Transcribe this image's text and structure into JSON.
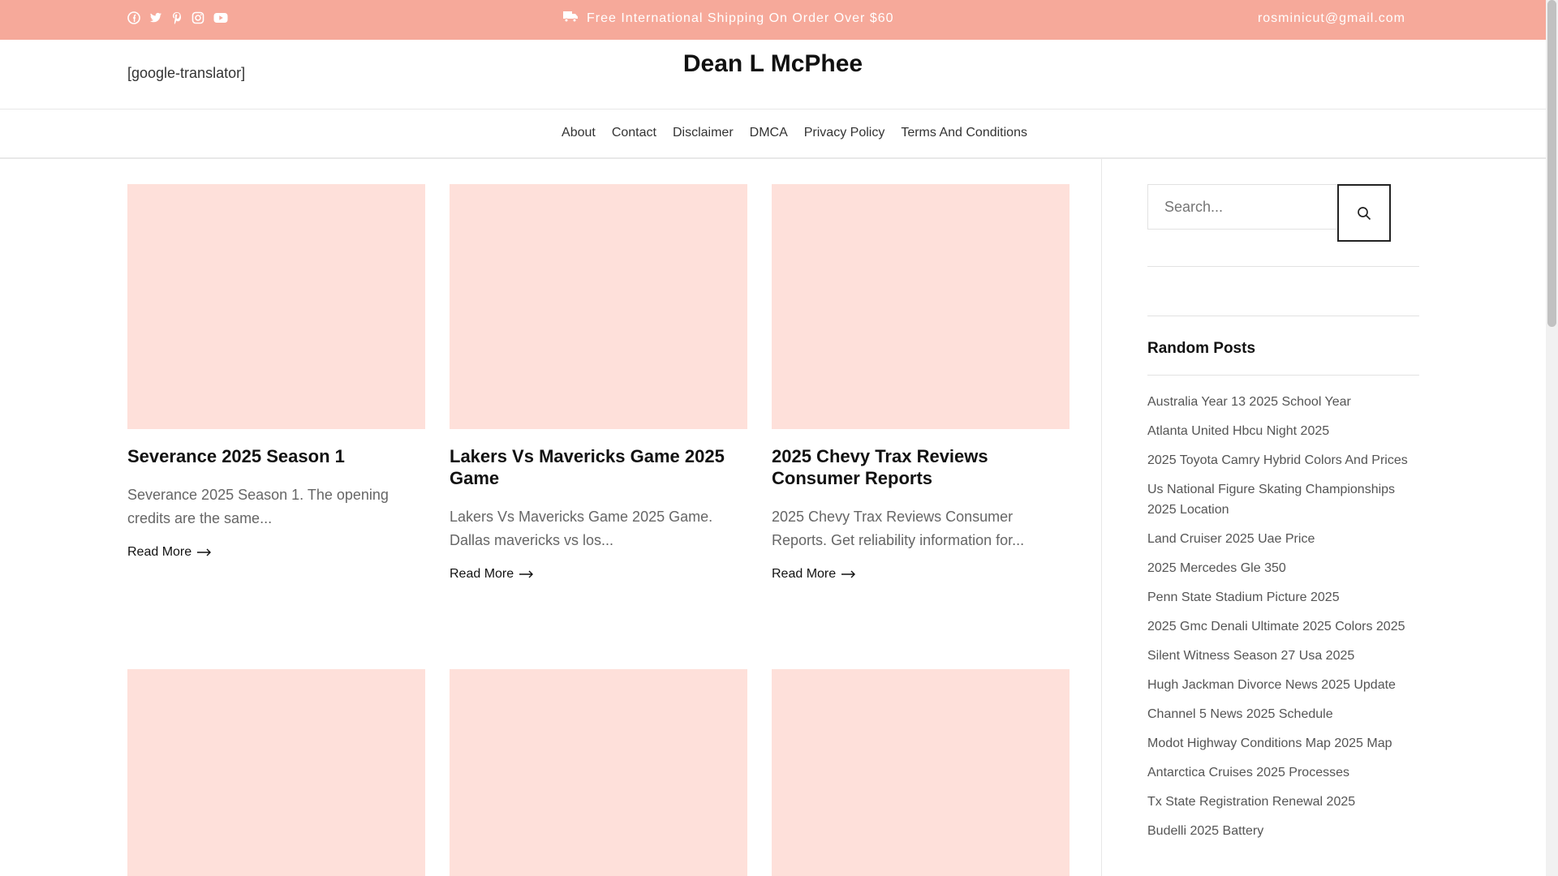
{
  "topbar": {
    "social_icons": [
      "facebook-icon",
      "twitter-icon",
      "pinterest-icon",
      "instagram-icon",
      "youtube-icon"
    ],
    "shipping_text": "Free International Shipping On Order Over $60",
    "email": "rosminicut@gmail.com",
    "background": "#f6a99a"
  },
  "header": {
    "translator": "[google-translator]",
    "site_title": "Dean L McPhee"
  },
  "nav": {
    "items": [
      "About",
      "Contact",
      "Disclaimer",
      "DMCA",
      "Privacy Policy",
      "Terms And Conditions"
    ]
  },
  "posts": [
    {
      "title": "Severance 2025 Season 1",
      "excerpt": "Severance 2025 Season 1. The opening credits are the same...",
      "read_more": "Read More"
    },
    {
      "title": "Lakers Vs Mavericks Game 2025 Game",
      "excerpt": "Lakers Vs Mavericks Game 2025 Game. Dallas mavericks vs los...",
      "read_more": "Read More"
    },
    {
      "title": "2025 Chevy Trax Reviews Consumer Reports",
      "excerpt": "2025 Chevy Trax Reviews Consumer Reports. Get reliability information for...",
      "read_more": "Read More"
    }
  ],
  "thumbnail_color": "#fee0da",
  "sidebar": {
    "search_placeholder": "Search...",
    "random_posts_title": "Random Posts",
    "random_posts": [
      "Australia Year 13 2025 School Year",
      "Atlanta United Hbcu Night 2025",
      "2025 Toyota Camry Hybrid Colors And Prices",
      "Us National Figure Skating Championships 2025 Location",
      "Land Cruiser 2025 Uae Price",
      "2025 Mercedes Gle 350",
      "Penn State Stadium Picture 2025",
      "2025 Gmc Denali Ultimate 2025 Colors 2025",
      "Silent Witness Season 27 Usa 2025",
      "Hugh Jackman Divorce News 2025 Update",
      "Channel 5 News 2025 Schedule",
      "Modot Highway Conditions Map 2025 Map",
      "Antarctica Cruises 2025 Processes",
      "Tx State Registration Renewal 2025",
      "Budelli 2025 Battery"
    ]
  }
}
